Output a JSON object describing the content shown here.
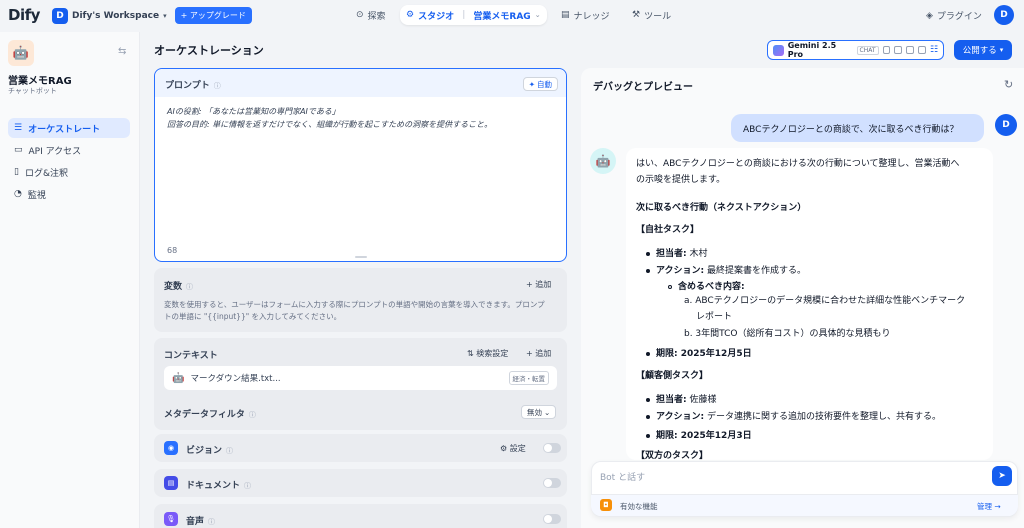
{
  "topbar": {
    "logo": "Dify",
    "workspace_initial": "D",
    "workspace_name": "Dify's Workspace",
    "workspace_caret": "▾",
    "upgrade_label": "+ アップグレード",
    "nav_explore": "探索",
    "nav_studio": "スタジオ",
    "nav_current_app": "営業メモRAG",
    "nav_knowledge": "ナレッジ",
    "nav_tools": "ツール",
    "plugins": "プラグイン",
    "user_initial": "D"
  },
  "sidebar": {
    "app_name": "営業メモRAG",
    "app_type": "チャットボット",
    "items": [
      {
        "label": "オーケストレート",
        "icon": "list-icon"
      },
      {
        "label": "API アクセス",
        "icon": "terminal-icon"
      },
      {
        "label": "ログ&注釈",
        "icon": "file-icon"
      },
      {
        "label": "監視",
        "icon": "monitor-icon"
      }
    ]
  },
  "main": {
    "title": "オーケストレーション",
    "model_name": "Gemini 2.5 Pro",
    "model_tag": "CHAT",
    "publish_label": "公開する"
  },
  "prompt": {
    "label": "プロンプト",
    "auto_label": "自動",
    "line1": "AIの役割: 「あなたは営業知の専門家AIである」",
    "line2": "回答の目的: 単に情報を返すだけでなく、組織が行動を起こすための洞察を提供すること。",
    "char_count": "68"
  },
  "variables": {
    "label": "変数",
    "add_label": "+ 追加",
    "desc_line1": "変数を使用すると、ユーザーはフォームに入力する際にプロンプトの単語や開始の言葉を導入できます。プロンプ",
    "desc_line2": "トの単語に \"{{input}}\" を入力してみてください。"
  },
  "context": {
    "label": "コンテキスト",
    "retrieval_label": "検索設定",
    "add_label": "+ 追加",
    "file_name": "マークダウン結果.txt...",
    "file_tag": "経済・転置"
  },
  "metadata": {
    "label": "メタデータフィルタ",
    "value": "無効"
  },
  "features": {
    "vision": {
      "label": "ビジョン",
      "settings_label": "設定"
    },
    "document": {
      "label": "ドキュメント"
    },
    "audio": {
      "label": "音声"
    }
  },
  "debug": {
    "title": "デバッグとプレビュー",
    "user_initial": "D",
    "user_message": "ABCテクノロジーとの商談で、次に取るべき行動は？",
    "bot": {
      "intro1": "はい、ABCテクノロジーとの商談における次の行動について整理し、営業活動へ",
      "intro2": "の示唆を提供します。",
      "heading": "次に取るべき行動（ネクストアクション）",
      "own_task": "【自社タスク】",
      "assignee_label": "担当者:",
      "assignee1": " 木村",
      "action_label": "アクション:",
      "action1": " 最終提案書を作成する。",
      "include_label": "含めるべき内容:",
      "sub_a1": "a. ABCテクノロジーのデータ規模に合わせた詳細な性能ベンチマーク",
      "sub_a2": "レポート",
      "sub_b": "b. 3年間TCO（総所有コスト）の具体的な見積もり",
      "deadline_label": "期限:",
      "deadline1": " 2025年12月5日",
      "client_task": "【顧客側タスク】",
      "assignee2": " 佐藤様",
      "action2": " データ連携に関する追加の技術要件を整理し、共有する。",
      "deadline2": " 2025年12月3日",
      "both_task": "【双方のタスク】"
    },
    "input_placeholder": "Bot と話す",
    "features_label": "有効な機能",
    "manage_label": "管理 →"
  }
}
